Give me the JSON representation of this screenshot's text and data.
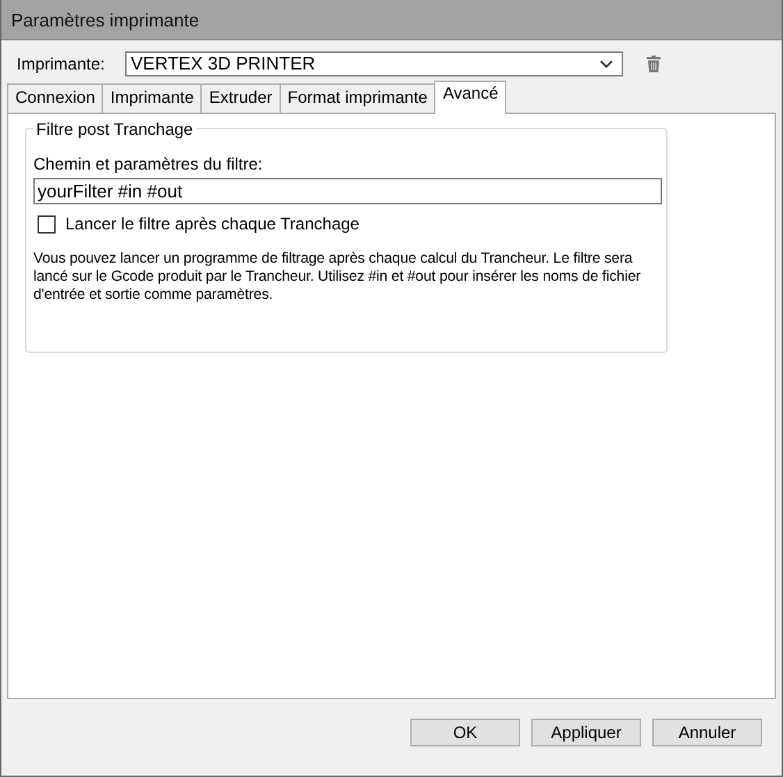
{
  "window": {
    "title": "Paramètres imprimante"
  },
  "printer": {
    "label": "Imprimante:",
    "value": "VERTEX 3D PRINTER"
  },
  "tabs": [
    {
      "label": "Connexion",
      "selected": false
    },
    {
      "label": "Imprimante",
      "selected": false
    },
    {
      "label": "Extruder",
      "selected": false
    },
    {
      "label": "Format imprimante",
      "selected": false
    },
    {
      "label": "Avancé",
      "selected": true
    }
  ],
  "group": {
    "title": "Filtre post Tranchage",
    "field_label": "Chemin et paramètres du filtre:",
    "field_value": "yourFilter #in #out",
    "checkbox": {
      "label": "Lancer le filtre après chaque Tranchage",
      "checked": false
    },
    "description": "Vous pouvez lancer un programme de filtrage après chaque calcul du Trancheur. Le filtre sera lancé sur le Gcode produit par le Trancheur. Utilisez #in et #out pour insérer les noms de fichier d'entrée et sortie comme paramètres."
  },
  "buttons": [
    "OK",
    "Appliquer",
    "Annuler"
  ]
}
